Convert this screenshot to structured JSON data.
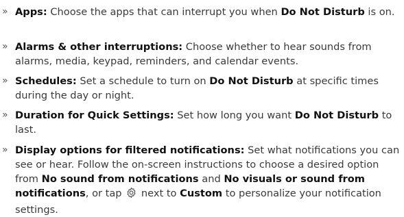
{
  "items": [
    {
      "bullet": "»",
      "term": "Apps:",
      "text1": " Choose the apps that can interrupt you when ",
      "dnd": "Do Not Disturb",
      "text2": " is on."
    },
    {
      "bullet": "»",
      "term": "Alarms & other interruptions:",
      "text1": " Choose whether to hear sounds from alarms, media, keypad, reminders, and calendar events."
    },
    {
      "bullet": "»",
      "term": "Schedules:",
      "text1": " Set a schedule to turn on ",
      "dnd": "Do Not Disturb",
      "text2": " at specific times during the day or night."
    },
    {
      "bullet": "»",
      "term": "Duration for Quick Settings:",
      "text1": " Set how long you want ",
      "dnd": "Do Not Disturb",
      "text2": " to last."
    },
    {
      "bullet": "»",
      "term": "Display options for filtered notifications:",
      "text1": " Set what notifications you can see or hear. Follow the on-screen instructions to choose a desired option from ",
      "opt1": "No sound from notifications",
      "text2": " and ",
      "opt2": "No visuals or sound from notifications",
      "text3": ", or tap ",
      "icon": "settings-gear-icon",
      "text4": " next to ",
      "custom": "Custom",
      "text5": " to personalize your notification settings."
    }
  ]
}
